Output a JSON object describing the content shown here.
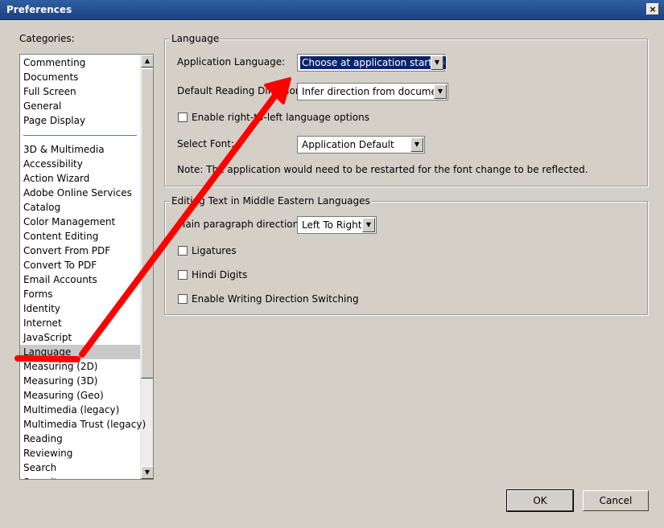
{
  "window": {
    "title": "Preferences",
    "close_glyph": "×"
  },
  "categories": {
    "heading": "Categories:",
    "top_items": [
      "Commenting",
      "Documents",
      "Full Screen",
      "General",
      "Page Display"
    ],
    "items": [
      "3D & Multimedia",
      "Accessibility",
      "Action Wizard",
      "Adobe Online Services",
      "Catalog",
      "Color Management",
      "Content Editing",
      "Convert From PDF",
      "Convert To PDF",
      "Email Accounts",
      "Forms",
      "Identity",
      "Internet",
      "JavaScript",
      "Language",
      "Measuring (2D)",
      "Measuring (3D)",
      "Measuring (Geo)",
      "Multimedia (legacy)",
      "Multimedia Trust (legacy)",
      "Reading",
      "Reviewing",
      "Search",
      "Security"
    ],
    "selected": "Language",
    "scroll_up_glyph": "▲",
    "scroll_down_glyph": "▼"
  },
  "language_group": {
    "legend": "Language",
    "app_language_label": "Application Language:",
    "app_language_value": "Choose at application startup",
    "reading_direction_label": "Default Reading Direction:",
    "reading_direction_value": "Infer direction from document",
    "rtl_option_label": "Enable right-to-left language options",
    "select_font_label": "Select Font:",
    "select_font_value": "Application Default",
    "note": "Note: The application would need to be restarted for the font change to be reflected."
  },
  "middle_east_group": {
    "legend": "Editing Text in Middle Eastern Languages",
    "paragraph_direction_label": "Main paragraph direction:",
    "paragraph_direction_value": "Left To Right",
    "ligatures_label": "Ligatures",
    "hindi_digits_label": "Hindi Digits",
    "writing_switch_label": "Enable Writing Direction Switching"
  },
  "buttons": {
    "ok": "OK",
    "cancel": "Cancel"
  },
  "dropdown_glyph": "▼",
  "annotation_color": "#ff0000"
}
